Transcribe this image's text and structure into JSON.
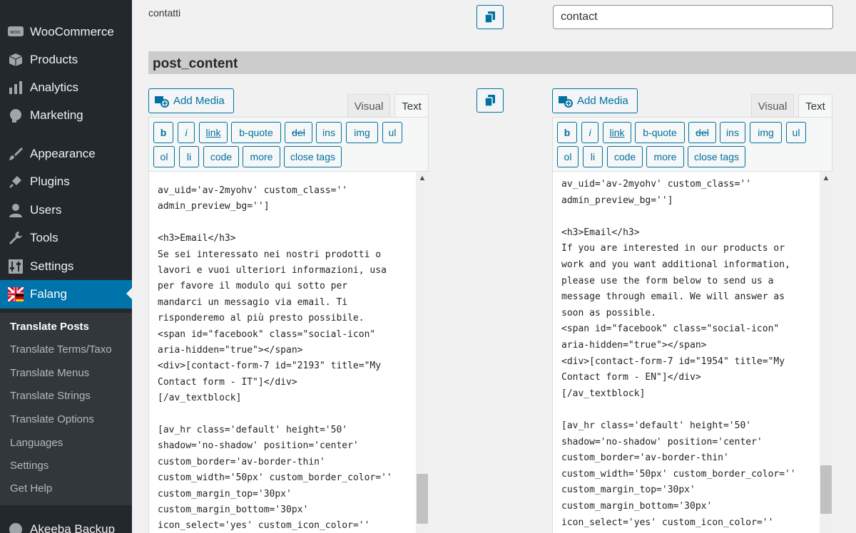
{
  "sidebar": {
    "menu": [
      {
        "label": "WooCommerce",
        "icon": "woocommerce-icon"
      },
      {
        "label": "Products",
        "icon": "products-box-icon"
      },
      {
        "label": "Analytics",
        "icon": "analytics-bars-icon"
      },
      {
        "label": "Marketing",
        "icon": "megaphone-icon"
      },
      {
        "label": "Appearance",
        "icon": "paintbrush-icon"
      },
      {
        "label": "Plugins",
        "icon": "plug-icon"
      },
      {
        "label": "Users",
        "icon": "user-icon"
      },
      {
        "label": "Tools",
        "icon": "wrench-icon"
      },
      {
        "label": "Settings",
        "icon": "settings-sliders-icon"
      },
      {
        "label": "Falang",
        "icon": "flag-icon"
      }
    ],
    "submenu": [
      "Translate Posts",
      "Translate Terms/Taxo",
      "Translate Menus",
      "Translate Strings",
      "Translate Options",
      "Languages",
      "Settings",
      "Get Help"
    ],
    "bottom_item": "Akeeba Backup",
    "colors": {
      "bg": "#23282d",
      "active": "#0073aa",
      "submenu_bg": "#32373c"
    }
  },
  "slug_row": {
    "label": "contatti",
    "value": "contact"
  },
  "section": {
    "title": "post_content"
  },
  "editor": {
    "add_media": "Add Media",
    "tab_visual": "Visual",
    "tab_text": "Text",
    "buttons": [
      "b",
      "i",
      "link",
      "b-quote",
      "del",
      "ins",
      "img",
      "ul",
      "ol",
      "li",
      "code",
      "more",
      "close tags"
    ]
  },
  "source_lines": [
    "av_uid='av-2myohv' custom_class=''",
    "admin_preview_bg='']",
    "",
    "<h3>Email</h3>",
    "Se sei interessato nei nostri prodotti o",
    "lavori e vuoi ulteriori informazioni, usa",
    "per favore il modulo qui sotto per",
    "mandarci un messagio via email. Ti",
    "risponderemo al più presto possibile.",
    "<span id=\"facebook\" class=\"social-icon\"",
    "aria-hidden=\"true\"></span>",
    "<div>[contact-form-7 id=\"2193\" title=\"My",
    "Contact form - IT\"]</div>",
    "[/av_textblock]",
    "",
    "[av_hr class='default' height='50'",
    "shadow='no-shadow' position='center'",
    "custom_border='av-border-thin'",
    "custom_width='50px' custom_border_color=''",
    "custom_margin_top='30px'",
    "custom_margin_bottom='30px'",
    "icon_select='yes' custom_icon_color=''"
  ],
  "target_lines": [
    "av_uid='av-2myohv' custom_class=''",
    "admin_preview_bg='']",
    "",
    "<h3>Email</h3>",
    "If you are interested in our products or",
    "work and you want additional information,",
    "please use the form below to send us a",
    "message through email. We will answer as",
    "soon as possible.",
    "<span id=\"facebook\" class=\"social-icon\"",
    "aria-hidden=\"true\"></span>",
    "<div>[contact-form-7 id=\"1954\" title=\"My",
    "Contact form - EN\"]</div>",
    "[/av_textblock]",
    "",
    "[av_hr class='default' height='50'",
    "shadow='no-shadow' position='center'",
    "custom_border='av-border-thin'",
    "custom_width='50px' custom_border_color=''",
    "custom_margin_top='30px'",
    "custom_margin_bottom='30px'",
    "icon_select='yes' custom_icon_color=''"
  ]
}
